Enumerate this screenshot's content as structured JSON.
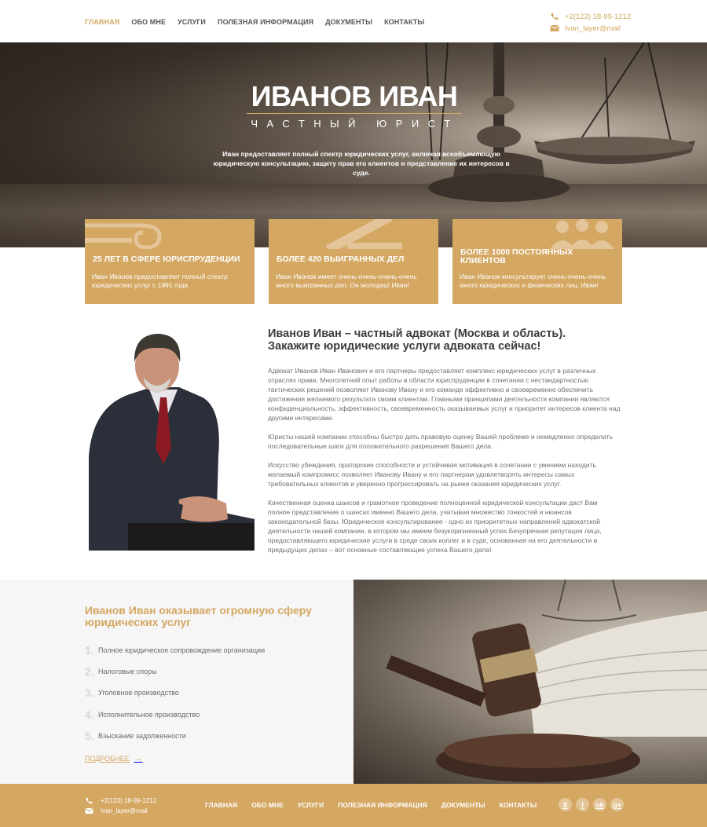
{
  "header": {
    "nav": [
      "ГЛАВНАЯ",
      "ОБО МНЕ",
      "УСЛУГИ",
      "ПОЛЕЗНАЯ ИНФОРМАЦИЯ",
      "ДОКУМЕНТЫ",
      "КОНТАКТЫ"
    ],
    "active_index": 0,
    "phone": "+2(123) 18-99-1212",
    "email": "Ivan_layer@mail"
  },
  "hero": {
    "title": "ИВАНОВ ИВАН",
    "subtitle": "ЧАСТНЫЙ ЮРИСТ",
    "description": "Иван предоставляет полный спектр юридических услуг, включая всеобъемлющую юридическую консультацию, защиту прав его клиентов и представление их интересов в суде."
  },
  "cards": [
    {
      "title": "25 ЛЕТ В СФЕРЕ ЮРИСПРУДЕНЦИИ",
      "text": "Иван Иванов предоставляет полный спектр юридических услуг с 1991 года",
      "icon": "column-icon"
    },
    {
      "title": "БОЛЕЕ 420 ВЫИГРАННЫХ ДЕЛ",
      "text": "Иван Иванов имеет очень-очень-очень-очень много выигранных дел. Он молодец! Иван!",
      "icon": "gavel-icon"
    },
    {
      "title": "БОЛЕЕ 1000 ПОСТОЯННЫХ КЛИЕНТОВ",
      "text": "Иван Иванов консультирует очень-очень-очень много юридических и физических лиц. Иван!",
      "icon": "people-icon"
    }
  ],
  "about": {
    "heading": "Иванов Иван – частный адвокат (Москва и область). Закажите юридические услуги адвоката сейчас!",
    "paragraphs": [
      "Адвокат Иванов Иван Иванович и его партнеры предоставляет комплекс юридических услуг в различных отраслях права. Многолетний опыт работы в области юриспруденции в сочетании с нестандартностью тактических решений позволяют Иванову Ивану и его команде эффективно и своевременно обеспечить достижения желаемого результата своим клиентам. Главными принципами деятельности компании являются конфиденциальность, эффективность, своевременность оказываемых услуг и приоритет интересов клиента над другими интересами.",
      "Юристы нашей компании способны быстро дать правовую оценку Вашей проблеме и немедленно определить последовательные шаги для положительного разрешения Вашего дела.",
      "Искусство убеждения, ораторские способности и устойчивая мотивация в сочетании с умением находить желаемый компромисс позволяет Иванову Ивану и его партнерам удовлетворять интересы самых требовательных клиентов и уверенно прогрессировать на рынке оказания юридических услуг.",
      "Качественная оценка шансов и грамотное проведение полноценной юридической консультации даст Вам полное представление о шансах именно Вашего дела, учитывая множество тонкостей и нюансов законодательной базы. Юридическое консультирование - одно из приоритетных направлений адвокатской деятельности нашей компании, в котором мы имеем безукоризненный успех.Безупречная репутация лица, предоставляющего юридические услуги в среде своих коллег и в суде, основанная на его деятельности в предыдущих делах – вот основные составляющие успеха Вашего дела!"
    ]
  },
  "services": {
    "heading": "Иванов Иван оказывает огромную сферу юридических услуг",
    "items": [
      {
        "num": "1.",
        "label": "Полное юридическое сопровождение организации"
      },
      {
        "num": "2.",
        "label": "Налоговые споры"
      },
      {
        "num": "3.",
        "label": "Уголовное производство"
      },
      {
        "num": "4.",
        "label": "Исполнительное производство"
      },
      {
        "num": "5.",
        "label": "Взыскание задолженности"
      }
    ],
    "more": "ПОДРОБНЕЕ",
    "more_arrow": "→"
  },
  "footer": {
    "phone": "+2(123) 18-99-1212",
    "email": "Ivan_layer@mail",
    "nav": [
      "ГЛАВНАЯ",
      "ОБО МНЕ",
      "УСЛУГИ",
      "ПОЛЕЗНАЯ ИНФОРМАЦИЯ",
      "ДОКУМЕНТЫ",
      "КОНТАКТЫ"
    ],
    "social": [
      {
        "icon": "skype-icon",
        "glyph": "S"
      },
      {
        "icon": "facebook-icon",
        "glyph": "f"
      },
      {
        "icon": "odnoklassniki-icon",
        "glyph": "ok"
      },
      {
        "icon": "google-plus-icon",
        "glyph": "g+"
      }
    ]
  },
  "colors": {
    "accent": "#d4a762",
    "text": "#555555",
    "footer_bg": "#d4a762"
  }
}
